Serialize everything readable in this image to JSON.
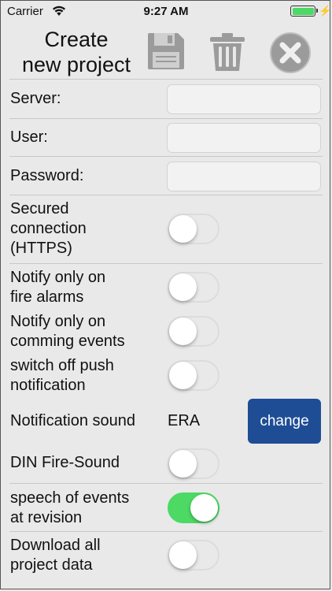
{
  "status_bar": {
    "carrier": "Carrier",
    "time": "9:27 AM"
  },
  "header": {
    "title_line1": "Create",
    "title_line2": "new project"
  },
  "fields": {
    "server_label": "Server:",
    "user_label": "User:",
    "password_label": "Password:"
  },
  "toggles": {
    "secured_line1": "Secured",
    "secured_line2": "connection",
    "secured_line3": "(HTTPS)",
    "fire_line1": "Notify only on",
    "fire_line2": "fire alarms",
    "events_line1": "Notify only on",
    "events_line2": "comming events",
    "push_line1": "switch off push",
    "push_line2": "notification",
    "din_label": "DIN Fire-Sound",
    "speech_line1": "speech of events",
    "speech_line2": "at revision",
    "download_line1": "Download all",
    "download_line2": "project data"
  },
  "notification_sound": {
    "label": "Notification sound",
    "value": "ERA",
    "change_label": "change"
  },
  "accent_colors": {
    "toggle_on": "#4cd964",
    "change_button": "#1f4d95"
  }
}
